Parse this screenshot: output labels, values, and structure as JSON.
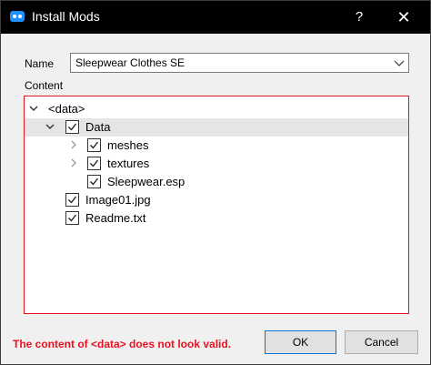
{
  "window": {
    "title": "Install Mods",
    "help_label": "?",
    "close_label": "✕"
  },
  "form": {
    "name_label": "Name",
    "name_value": "Sleepwear Clothes SE",
    "content_label": "Content"
  },
  "tree": {
    "items": [
      {
        "label": "<data>",
        "checkbox": false,
        "checked": false,
        "expander": "expanded",
        "depth": 0
      },
      {
        "label": "Data",
        "checkbox": true,
        "checked": true,
        "expander": "expanded",
        "depth": 1,
        "selected": true
      },
      {
        "label": "meshes",
        "checkbox": true,
        "checked": true,
        "expander": "collapsed",
        "depth": 2
      },
      {
        "label": "textures",
        "checkbox": true,
        "checked": true,
        "expander": "collapsed",
        "depth": 2
      },
      {
        "label": "Sleepwear.esp",
        "checkbox": true,
        "checked": true,
        "expander": "none",
        "depth": 2
      },
      {
        "label": "Image01.jpg",
        "checkbox": true,
        "checked": true,
        "expander": "none",
        "depth": 1
      },
      {
        "label": "Readme.txt",
        "checkbox": true,
        "checked": true,
        "expander": "none",
        "depth": 1
      }
    ]
  },
  "footer": {
    "error_message": "The content of <data> does not look valid.",
    "ok_label": "OK",
    "cancel_label": "Cancel"
  },
  "colors": {
    "titlebar": "#000000",
    "error": "#e81123",
    "accent": "#0078d7"
  },
  "icons": {
    "app": "mod-organizer-icon",
    "help": "help-icon",
    "close": "close-icon",
    "dropdown": "chevron-down-icon",
    "expanded": "chevron-down-icon",
    "collapsed": "chevron-right-icon",
    "check": "checkmark-icon"
  }
}
